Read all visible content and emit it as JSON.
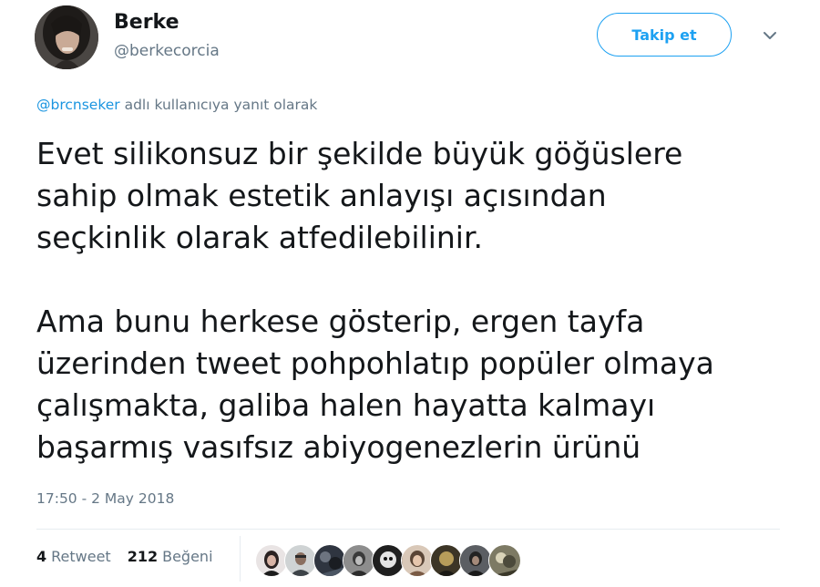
{
  "author": {
    "display_name": "Berke",
    "handle": "@berkecorcia",
    "avatar_icon": "profile-photo"
  },
  "actions": {
    "follow_label": "Takip et",
    "menu_icon": "chevron-down-icon"
  },
  "reply_context": {
    "mention": "@brcnseker",
    "suffix": " adlı kullanıcıya yanıt olarak"
  },
  "tweet": {
    "lines": [
      "Evet silikonsuz bir şekilde büyük göğüslere",
      "sahip olmak estetik anlayışı açısından",
      "seçkinlik olarak atfedilebilinir.",
      "Ama bunu herkese gösterip, ergen tayfa",
      "üzerinden tweet pohpohlatıp popüler olmaya",
      "çalışmakta, galiba halen hayatta kalmayı",
      "başarmış vasıfsız abiyogenezlerin ürünü"
    ],
    "timestamp": "17:50 - 2 May 2018"
  },
  "stats": {
    "retweet_count": "4",
    "retweet_label": "Retweet",
    "like_count": "212",
    "like_label": "Beğeni"
  },
  "colors": {
    "accent": "#1da1f2",
    "mention": "#1b95e0",
    "secondary_text": "#657786",
    "primary_text": "#14171a",
    "divider": "#e6ecf0"
  }
}
